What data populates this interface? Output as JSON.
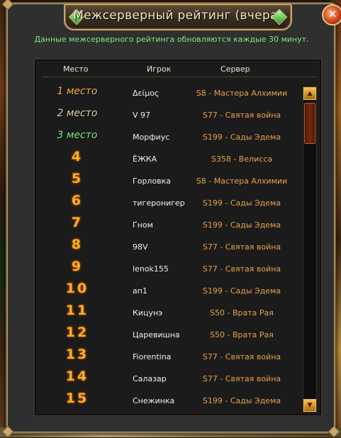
{
  "window": {
    "title": "Межсерверный рейтинг (вчера)",
    "close_label": "✕",
    "notice": "Данные межсерверного рейтинга обновляются каждые 30 минут."
  },
  "table": {
    "headers": {
      "place": "Место",
      "player": "Игрок",
      "server": "Сервер"
    },
    "rows": [
      {
        "place": "1 место",
        "player": "Δείμος",
        "server": "S8 - Мастера Алхимии"
      },
      {
        "place": "2 место",
        "player": "V 97",
        "server": "S77 - Святая война"
      },
      {
        "place": "3 место",
        "player": "Морфиус",
        "server": "S199 - Сады Эдема"
      },
      {
        "place": "4",
        "player": "ЁЖКА",
        "server": "S358 - Велисса"
      },
      {
        "place": "5",
        "player": "Горловка",
        "server": "S8 - Мастера Алхимии"
      },
      {
        "place": "6",
        "player": "тигеронигер",
        "server": "S199 - Сады Эдема"
      },
      {
        "place": "7",
        "player": "Гном",
        "server": "S199 - Сады Эдема"
      },
      {
        "place": "8",
        "player": "98V",
        "server": "S77 - Святая война"
      },
      {
        "place": "9",
        "player": "lenok155",
        "server": "S77 - Святая война"
      },
      {
        "place": "10",
        "player": "ап1",
        "server": "S199 - Сады Эдема"
      },
      {
        "place": "11",
        "player": "Кицунэ",
        "server": "S50 - Врата Рая"
      },
      {
        "place": "12",
        "player": "Царевишна",
        "server": "S50 - Врата Рая"
      },
      {
        "place": "13",
        "player": "Fiorentina",
        "server": "S77 - Святая война"
      },
      {
        "place": "14",
        "player": "Салазар",
        "server": "S77 - Святая война"
      },
      {
        "place": "15",
        "player": "Снежинка",
        "server": "S199 - Сады Эдема"
      }
    ]
  },
  "scrollbar": {
    "up_icon": "▲",
    "down_icon": "▼"
  },
  "colors": {
    "notice": "#7ee87a",
    "rank": "#ffb021",
    "server": "#e6a24a",
    "frame": "#c9a865"
  }
}
